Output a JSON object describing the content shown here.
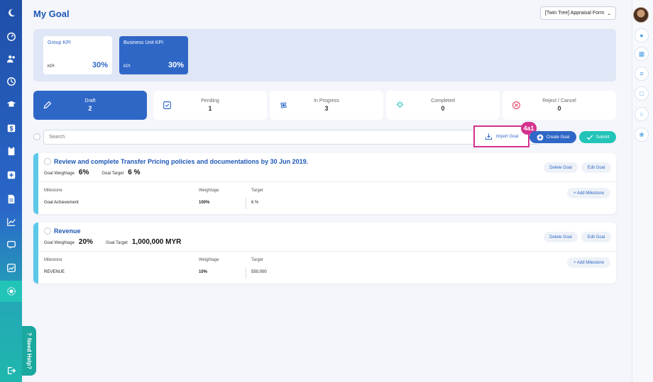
{
  "page_title": "My Goal",
  "form_select": {
    "value": "[Twin Tree] Appraisal Form"
  },
  "kpi_cards": [
    {
      "title": "Group KPI",
      "label": "KPI",
      "value": "30%"
    },
    {
      "title": "Business Unit KPI",
      "label": "KPI",
      "value": "30%"
    }
  ],
  "status_tabs": [
    {
      "label": "Draft",
      "count": "2"
    },
    {
      "label": "Pending",
      "count": "1"
    },
    {
      "label": "In Progress",
      "count": "3"
    },
    {
      "label": "Completed",
      "count": "0"
    },
    {
      "label": "Reject / Cancel",
      "count": "0"
    }
  ],
  "search": {
    "placeholder": "Search"
  },
  "actions": {
    "import": "Import Goal",
    "create": "Create Goal",
    "submit": "Submit",
    "badge": "4a1"
  },
  "goals": [
    {
      "title": "Review and complete Transfer Pricing policies and documentations by 30 Jun 2019.",
      "weightage_label": "Goal Weightage",
      "weightage": "6%",
      "target_label": "Goal Target",
      "target": "6 %",
      "delete": "Delete Goal",
      "edit": "Edit Goal",
      "add_milestone": "+ Add Milestone",
      "headers": {
        "milestone": "Milestone",
        "weightage": "Weightage",
        "target": "Target"
      },
      "milestone": {
        "name": "Goal Achievement",
        "weightage": "100%",
        "target": "6 %"
      }
    },
    {
      "title": "Revenue",
      "weightage_label": "Goal Weightage",
      "weightage": "20%",
      "target_label": "Goal Target",
      "target": "1,000,000 MYR",
      "delete": "Delete Goal",
      "edit": "Edit Goal",
      "add_milestone": "+ Add Milestone",
      "headers": {
        "milestone": "Milestone",
        "weightage": "Weightage",
        "target": "Target"
      },
      "milestone": {
        "name": "REVENUE",
        "weightage": "10%",
        "target": "550,000"
      }
    }
  ],
  "need_help": "Need Help?",
  "colors": {
    "primary": "#2f67c7",
    "teal": "#22c4b8",
    "accent": "#5bc8ea",
    "highlight": "#d3318f"
  }
}
